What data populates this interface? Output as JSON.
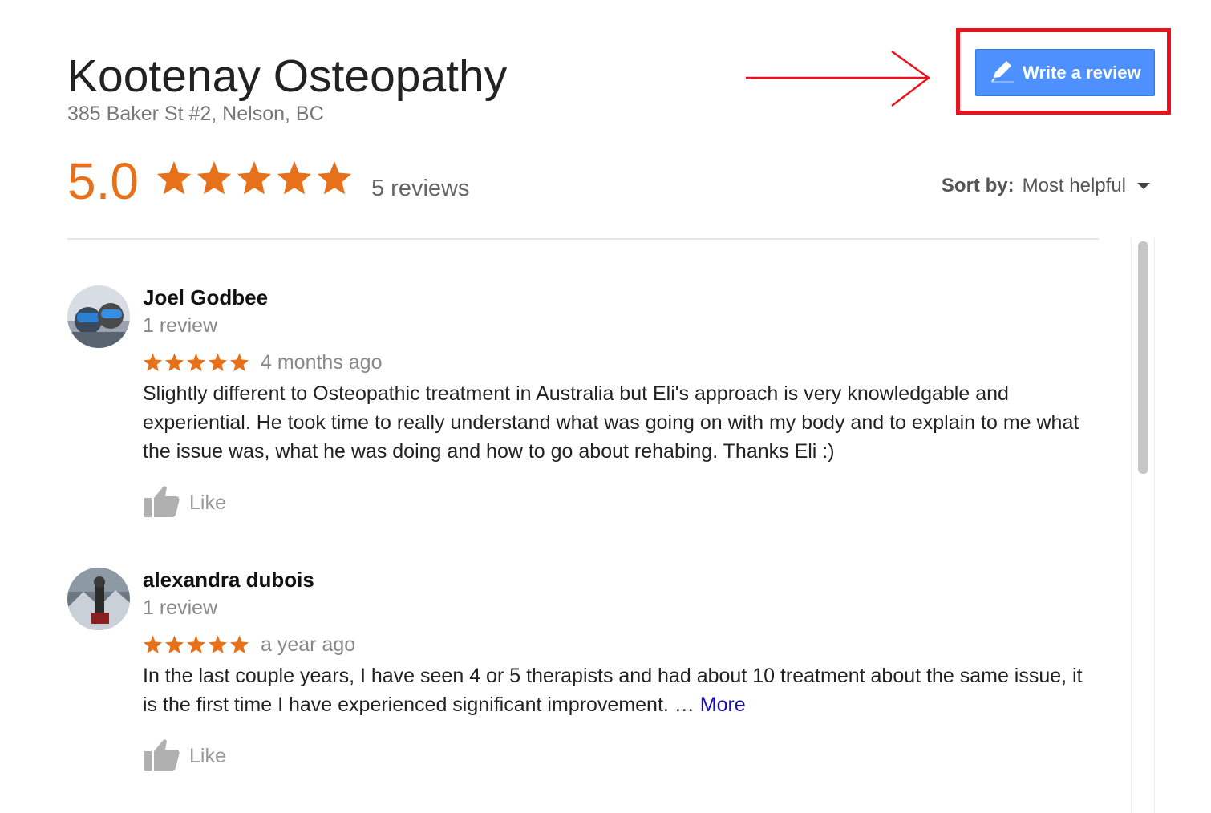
{
  "business": {
    "name": "Kootenay Osteopathy",
    "address": "385 Baker St #2, Nelson, BC"
  },
  "write_review_label": "Write a review",
  "summary": {
    "rating": "5.0",
    "stars": 5,
    "review_count": "5 reviews"
  },
  "sort": {
    "label": "Sort by:",
    "value": "Most helpful"
  },
  "colors": {
    "star": "#e7711b",
    "button": "#4d90fe",
    "highlight": "#e8131c",
    "link": "#1a0dab"
  },
  "reviews": [
    {
      "name": "Joel Godbee",
      "meta": "1 review",
      "stars": 5,
      "time": "4 months ago",
      "text": "Slightly different to Osteopathic treatment in Australia but Eli's approach is very knowledgable and experiential. He took time to really understand what was going on with my body and to explain to me what the issue was, what he was doing and how to go about rehabing. Thanks Eli :)",
      "more": "",
      "like": "Like"
    },
    {
      "name": "alexandra dubois",
      "meta": "1 review",
      "stars": 5,
      "time": "a year ago",
      "text": "In the last couple years, I have seen 4 or 5 therapists and had about 10 treatment about the same issue, it is the first time I have experienced significant improvement. … ",
      "more": "More",
      "like": "Like"
    }
  ]
}
